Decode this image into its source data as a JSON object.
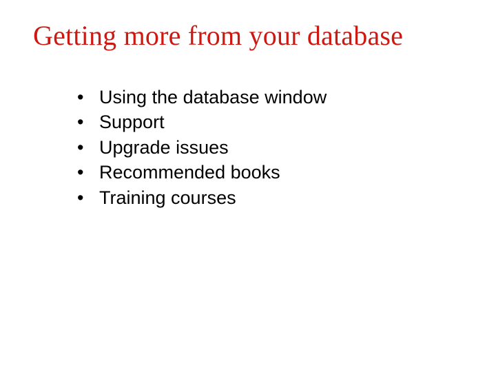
{
  "title": "Getting more from your database",
  "bullets": [
    "Using the database window",
    "Support",
    "Upgrade issues",
    "Recommended books",
    "Training courses"
  ]
}
